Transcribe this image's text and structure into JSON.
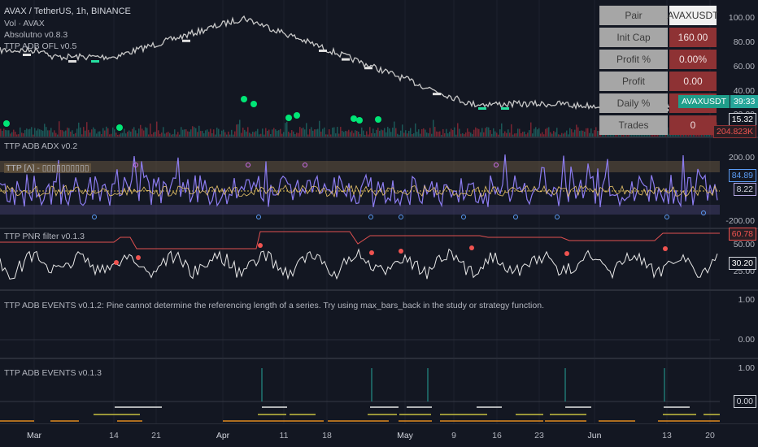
{
  "header": {
    "symbol": "AVAX / TetherUS, 1h, BINANCE",
    "vol": "Vol · AVAX",
    "ind1": "Absolutno v0.8.3",
    "ind2": "TTP ADB OFL v0.5"
  },
  "stats_table": [
    {
      "k": "Pair",
      "v": "AVAXUSDT"
    },
    {
      "k": "Init Cap",
      "v": "160.00"
    },
    {
      "k": "Profit %",
      "v": "0.00%"
    },
    {
      "k": "Profit",
      "v": "0.00"
    },
    {
      "k": "Daily %",
      "v": ""
    },
    {
      "k": "Trades",
      "v": "0"
    }
  ],
  "main_axis": {
    "ticks": [
      "100.00",
      "80.00",
      "60.00",
      "40.00",
      "20.00"
    ],
    "symbol_badge": "AVAXUSDT",
    "countdown": "39:33",
    "price": "15.32",
    "volume": "204.823K"
  },
  "adx": {
    "title": "TTP ADB ADX v0.2",
    "band_label": "TTP [Λ] - ▯▯▯▯▯▯▯▯▯▯",
    "ticks": [
      "200.00",
      "-200.00"
    ],
    "val1": "84.89",
    "val2": "8.22"
  },
  "pnr": {
    "title": "TTP PNR filter v0.1.3",
    "ticks": [
      "50.00",
      "25.00"
    ],
    "val1": "60.78",
    "val2": "30.20"
  },
  "events1": {
    "title": "TTP ADB EVENTS v0.1.2: Pine cannot determine the referencing length of a series. Try using max_bars_back in the study or strategy function.",
    "ticks": [
      "1.00",
      "0.00"
    ]
  },
  "events2": {
    "title": "TTP ADB EVENTS v0.1.3",
    "ticks": [
      "1.00"
    ],
    "val": "0.00"
  },
  "time_axis": [
    "Mar",
    "14",
    "21",
    "Apr",
    "11",
    "18",
    "May",
    "9",
    "16",
    "23",
    "Jun",
    "13",
    "20"
  ],
  "colors": {
    "bg": "#131722",
    "teal": "#26a69a",
    "red": "#f05350",
    "blue": "#5b9cf6",
    "purple": "#b36cf0",
    "green": "#00e676"
  }
}
